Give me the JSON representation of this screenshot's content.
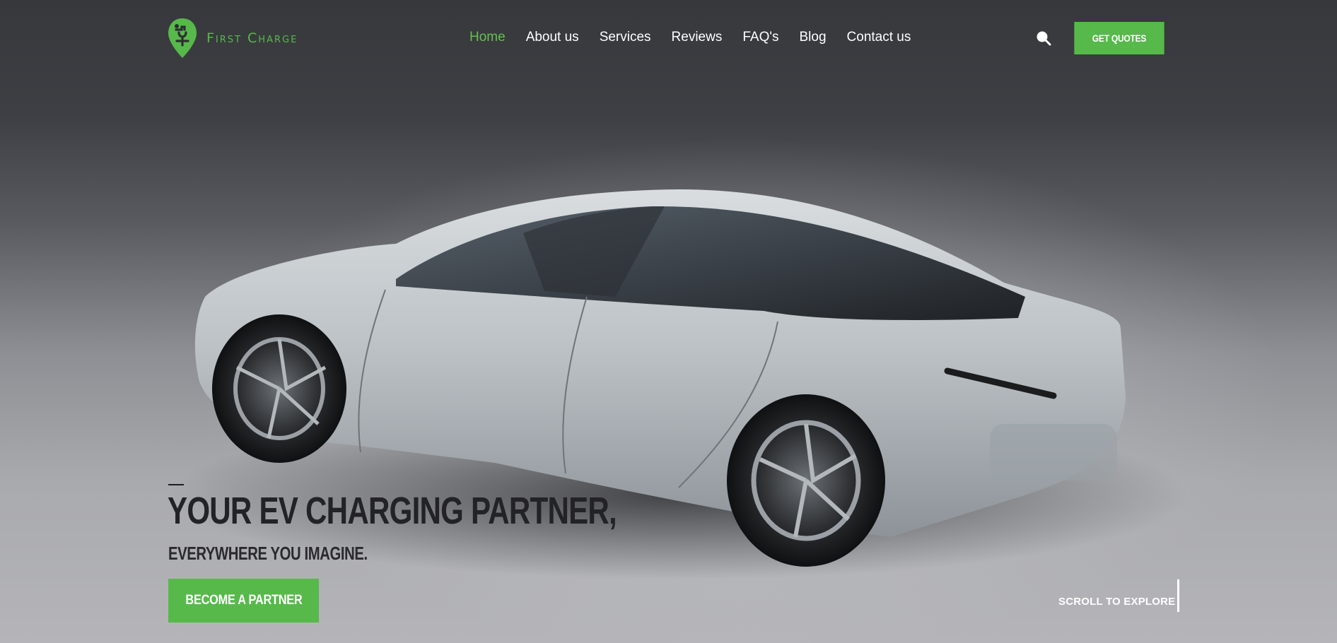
{
  "brand": {
    "name": "First Charge",
    "accent": "#56b94a"
  },
  "nav": {
    "items": [
      {
        "label": "Home",
        "active": true
      },
      {
        "label": "About us"
      },
      {
        "label": "Services"
      },
      {
        "label": "Reviews"
      },
      {
        "label": "FAQ's"
      },
      {
        "label": "Blog"
      },
      {
        "label": "Contact us"
      }
    ],
    "search_icon": "search-icon",
    "quote_button": "GET QUOTES"
  },
  "hero": {
    "headline": "YOUR EV CHARGING PARTNER,",
    "subheadline": "EVERYWHERE YOU IMAGINE.",
    "cta": "BECOME A PARTNER",
    "scroll_label": "SCROLL TO EXPLORE"
  }
}
